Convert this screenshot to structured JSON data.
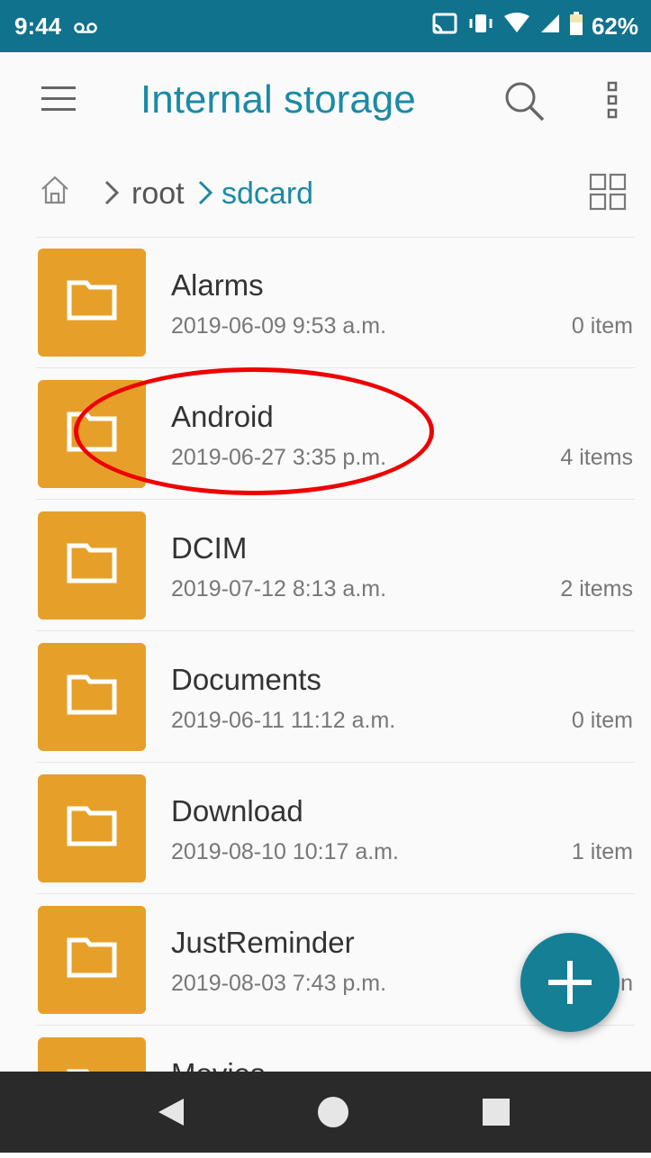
{
  "status_bar": {
    "time": "9:44",
    "battery": "62%",
    "icons": [
      "voicemail-icon",
      "cast-icon",
      "vibrate-icon",
      "wifi-icon",
      "signal-icon",
      "battery-icon"
    ]
  },
  "app_bar": {
    "title": "Internal storage",
    "icons": [
      "menu-icon",
      "search-icon",
      "more-vert-icon"
    ]
  },
  "breadcrumb": {
    "items": [
      "root",
      "sdcard"
    ],
    "icons": [
      "home-icon",
      "grid-view-icon"
    ]
  },
  "files": [
    {
      "name": "Alarms",
      "date": "2019-06-09 9:53 a.m.",
      "count": "0 item"
    },
    {
      "name": "Android",
      "date": "2019-06-27 3:35 p.m.",
      "count": "4 items"
    },
    {
      "name": "DCIM",
      "date": "2019-07-12 8:13 a.m.",
      "count": "2 items"
    },
    {
      "name": "Documents",
      "date": "2019-06-11 11:12 a.m.",
      "count": "0 item"
    },
    {
      "name": "Download",
      "date": "2019-08-10 10:17 a.m.",
      "count": "1 item"
    },
    {
      "name": "JustReminder",
      "date": "2019-08-03 7:43 p.m.",
      "count": "n"
    },
    {
      "name": "Movies",
      "date": "",
      "count": ""
    }
  ],
  "fab": {
    "icon": "plus-icon"
  },
  "nav_bar": {
    "icons": [
      "back-icon",
      "home-circle-icon",
      "recents-icon"
    ]
  },
  "colors": {
    "status_bar": "#10728c",
    "accent": "#1b8aa6",
    "folder": "#e6a029",
    "fab": "#157f96",
    "annotation": "#e00000"
  }
}
